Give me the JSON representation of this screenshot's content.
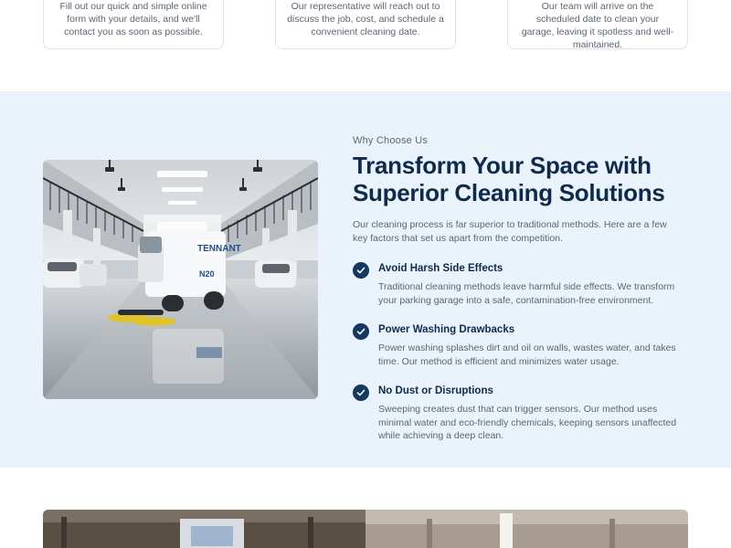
{
  "steps": [
    {
      "text": "Fill out our quick and simple online form with your details, and we'll contact you as soon as possible."
    },
    {
      "text": "Our representative will reach out to discuss the job, cost, and schedule a convenient cleaning date."
    },
    {
      "text": "Our team will arrive on the scheduled date to clean your garage, leaving it spotless and well-maintained."
    }
  ],
  "why": {
    "eyebrow": "Why Choose Us",
    "headline_line1": "Transform Your Space with",
    "headline_line2": "Superior Cleaning Solutions",
    "intro": "Our cleaning process is far superior to traditional methods. Here are a few key factors that set us apart from the competition.",
    "features": [
      {
        "title": "Avoid Harsh Side Effects",
        "desc": "Traditional cleaning methods leave harmful side effects. We transform your parking garage into a safe, contamination-free environment."
      },
      {
        "title": "Power Washing Drawbacks",
        "desc": "Power washing splashes dirt and oil on walls, wastes water, and takes time. Our method is efficient and minimizes water usage."
      },
      {
        "title": "No Dust or Disruptions",
        "desc": "Sweeping creates dust that can trigger sensors. Our method uses minimal water and eco-friendly chemicals, keeping sensors unaffected while achieving a deep clean."
      }
    ],
    "feature_icon": "check-circle-icon",
    "machine_brand": "TENNANT",
    "machine_model": "N20"
  },
  "colors": {
    "section_bg": "#eaf3fc",
    "heading": "#0f2a4a",
    "icon_bg": "#14385f",
    "body_text": "#5b6674"
  }
}
